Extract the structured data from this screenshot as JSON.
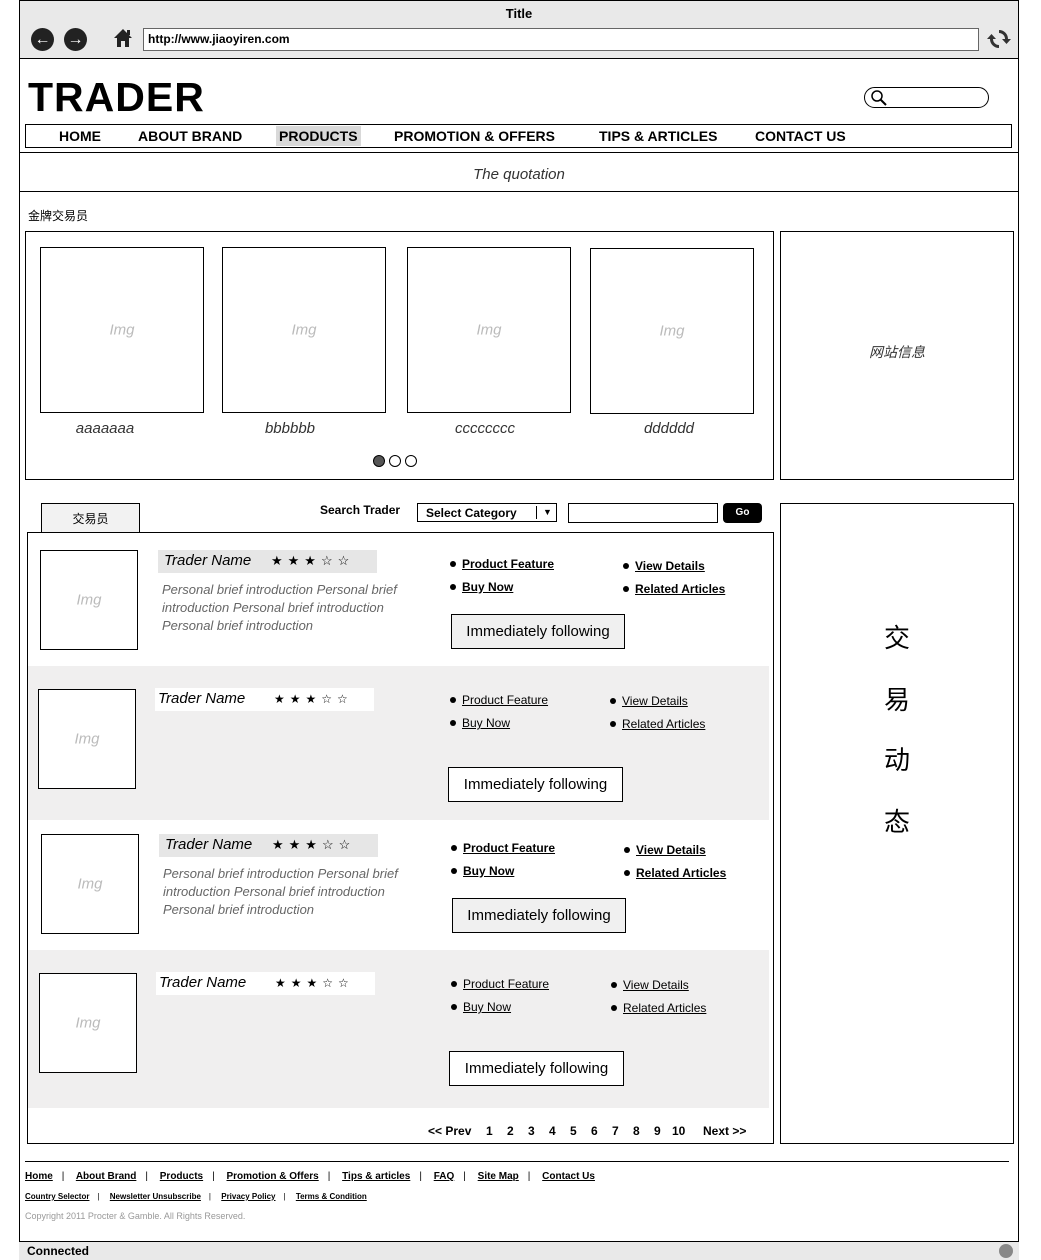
{
  "browser": {
    "title": "Title",
    "url": "http://www.jiaoyiren.com",
    "status": "Connected"
  },
  "header": {
    "logo": "TRADER",
    "search_placeholder": ""
  },
  "nav": {
    "items": [
      "HOME",
      "ABOUT BRAND",
      "PRODUCTS",
      "PROMOTION & OFFERS",
      "TIPS & ARTICLES",
      "CONTACT US"
    ],
    "active": "PRODUCTS"
  },
  "quotation": "The quotation",
  "gold_traders": {
    "label": "金牌交易员",
    "img_label": "Img",
    "items": [
      {
        "caption": "aaaaaaa"
      },
      {
        "caption": "bbbbbb"
      },
      {
        "caption": "cccccccc"
      },
      {
        "caption": "dddddd"
      }
    ],
    "carousel_pages": 3,
    "carousel_active": 1
  },
  "site_info": "网站信息",
  "trader_section": {
    "tab": "交易员",
    "search_label": "Search Trader",
    "category": "Select Category",
    "search_value": "",
    "go": "Go",
    "traders": [
      {
        "name": "Trader Name",
        "stars": "★★★☆☆",
        "rating": 3,
        "intro": "Personal brief introduction Personal brief introduction Personal brief introduction Personal brief introduction",
        "product_feature": "Product Feature",
        "buy_now": "Buy Now",
        "view_details": "View Details",
        "related_articles": "Related Articles",
        "follow": "Immediately following"
      },
      {
        "name": "Trader Name",
        "stars": "★★★☆☆",
        "rating": 3,
        "intro": "",
        "product_feature": "Product Feature",
        "buy_now": "Buy Now",
        "view_details": "View Details",
        "related_articles": "Related Articles",
        "follow": "Immediately following"
      },
      {
        "name": "Trader Name",
        "stars": "★★★☆☆",
        "rating": 3,
        "intro": "Personal brief introduction Personal brief introduction Personal brief introduction Personal brief introduction",
        "product_feature": "Product Feature",
        "buy_now": "Buy Now",
        "view_details": "View Details",
        "related_articles": "Related Articles",
        "follow": "Immediately following"
      },
      {
        "name": "Trader Name",
        "stars": "★★★☆☆",
        "rating": 3,
        "intro": "",
        "product_feature": "Product Feature",
        "buy_now": "Buy Now",
        "view_details": "View Details",
        "related_articles": "Related Articles",
        "follow": "Immediately following"
      }
    ],
    "pagination": {
      "prev": "<< Prev",
      "pages": [
        "1",
        "2",
        "3",
        "4",
        "5",
        "6",
        "7",
        "8",
        "9",
        "10"
      ],
      "next": "Next >>"
    }
  },
  "dynamics": [
    "交",
    "易",
    "动",
    "态"
  ],
  "footer": {
    "links": [
      "Home",
      "About Brand",
      "Products",
      "Promotion & Offers",
      "Tips & articles",
      "FAQ",
      "Site Map",
      "Contact Us"
    ],
    "links2": [
      "Country Selector",
      "Newsletter Unsubscribe",
      "Privacy Policy",
      "Terms & Condition"
    ],
    "copyright": "Copyright 2011 Procter & Gamble. All Rights Reserved."
  }
}
